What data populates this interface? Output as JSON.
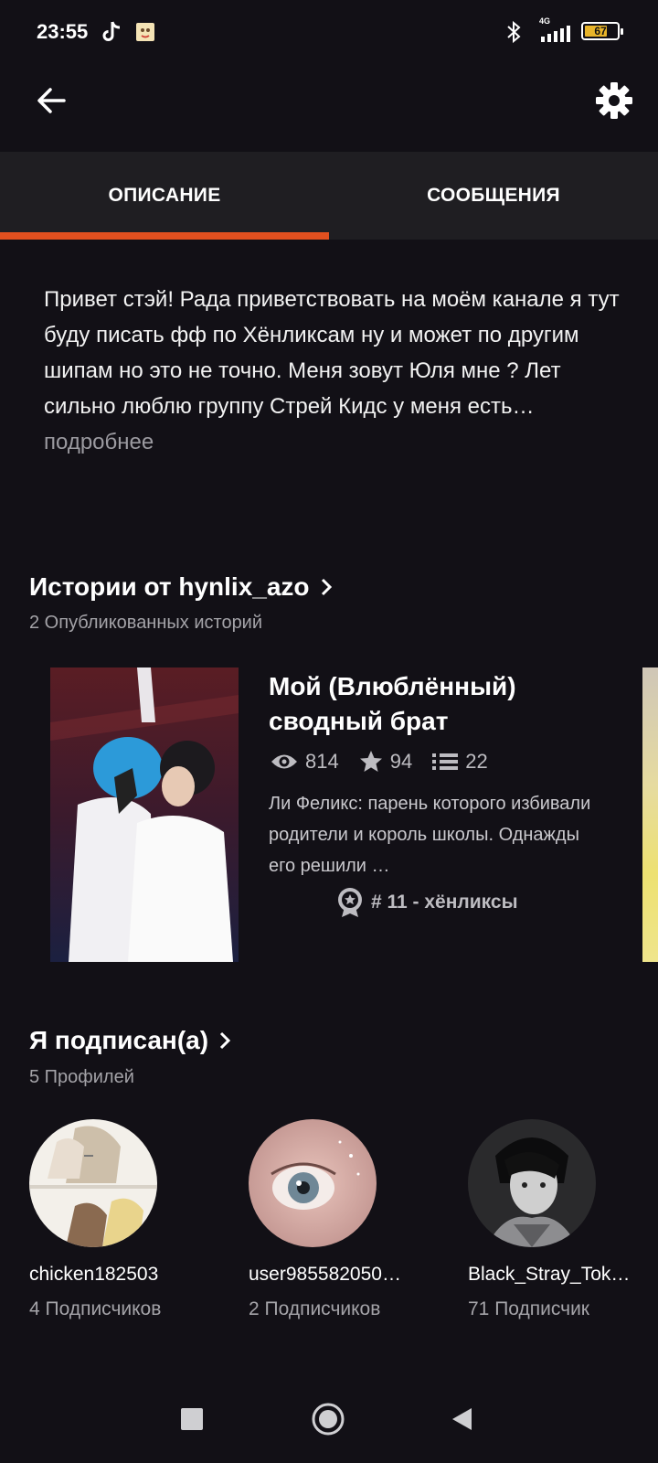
{
  "status_bar": {
    "time": "23:55",
    "network": "4G",
    "battery": "67",
    "icons": [
      "tiktok-icon",
      "sticker-icon",
      "bluetooth-icon",
      "signal-icon",
      "battery-icon"
    ]
  },
  "header": {
    "back_icon": "arrow-left-icon",
    "settings_icon": "gear-icon"
  },
  "tabs": [
    {
      "label": "ОПИСАНИЕ",
      "active": true
    },
    {
      "label": "СООБЩЕНИЯ",
      "active": false
    }
  ],
  "description": {
    "text": "Привет стэй! Рада приветствовать на моём канале я тут буду писать фф по Хёнликсам ну и может по другим шипам но это не точно. Меня зовут Юля мне ? Лет сильно люблю группу Стрей Кидс у меня есть…",
    "more": " подробнее"
  },
  "stories_section": {
    "title": "Истории от hynlix_azo",
    "subtitle": "2 Опубликованных историй",
    "story": {
      "title": "Мой (Влюблённый) сводный брат",
      "views": "814",
      "votes": "94",
      "parts": "22",
      "description": "Ли Феликс: парень которого избивали родители и король школы. Однажды его решили …",
      "rank": "# 11 - хёнликсы"
    }
  },
  "following_section": {
    "title": "Я подписан(а)",
    "subtitle": "5 Профилей",
    "profiles": [
      {
        "name": "chicken182503",
        "followers": "4 Подписчиков"
      },
      {
        "name": "user985582050…",
        "followers": "2 Подписчиков"
      },
      {
        "name": "Black_Stray_Tok…",
        "followers": "71 Подписчик"
      }
    ]
  },
  "colors": {
    "background": "#121016",
    "accent": "#e2501f",
    "tab_bar": "#1f1e22",
    "muted_text": "#a4a3a8"
  },
  "nav_bar": {
    "icons": [
      "recents-square-icon",
      "home-circle-icon",
      "back-triangle-icon"
    ]
  }
}
